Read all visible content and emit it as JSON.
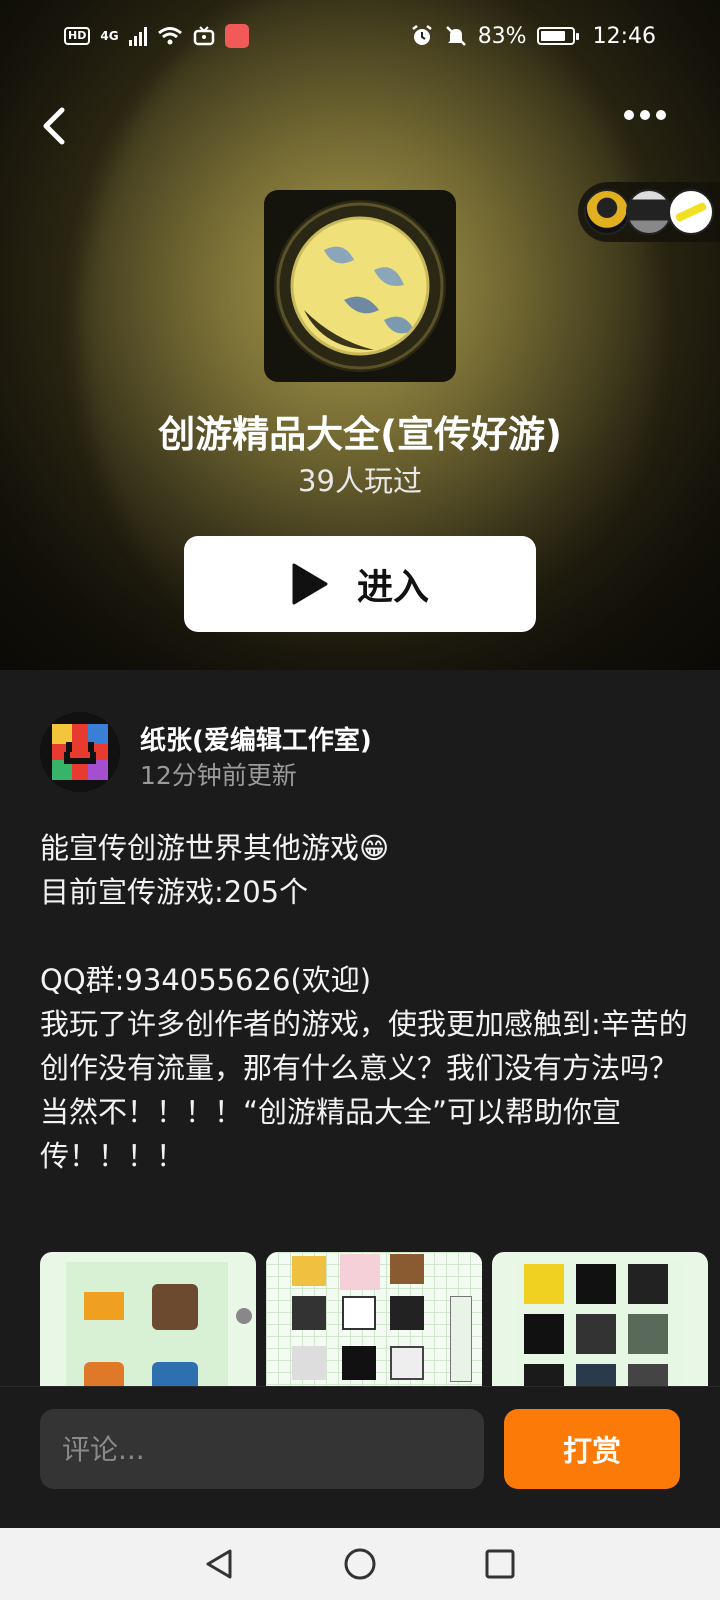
{
  "statusbar": {
    "hd": "HD",
    "network": "4G",
    "battery_percent": "83%",
    "time": "12:46",
    "battery_level": 0.83
  },
  "game": {
    "title": "创游精品大全(宣传好游)",
    "played": "39人玩过",
    "enter_label": "进入"
  },
  "author": {
    "name": "纸张(爱编辑工作室)",
    "updated": "12分钟前更新"
  },
  "description": [
    "能宣传创游世界其他游戏😁",
    "目前宣传游戏:205个",
    "",
    "QQ群:934055626(欢迎)",
    "我玩了许多创作者的游戏，使我更加感触到:辛苦的创作没有流量，那有什么意义？我们没有方法吗？当然不！！！！“创游精品大全”可以帮助你宣传！！！！"
  ],
  "bottom": {
    "comment_placeholder": "评论...",
    "tip_label": "打赏"
  },
  "colors": {
    "accent": "#fb7a08",
    "background": "#1b1b1b"
  },
  "icons": {
    "back": "back-arrow-icon",
    "more": "more-dots-icon",
    "play": "play-icon",
    "nav_back": "nav-back-icon",
    "nav_home": "nav-home-icon",
    "nav_recent": "nav-recent-icon"
  }
}
